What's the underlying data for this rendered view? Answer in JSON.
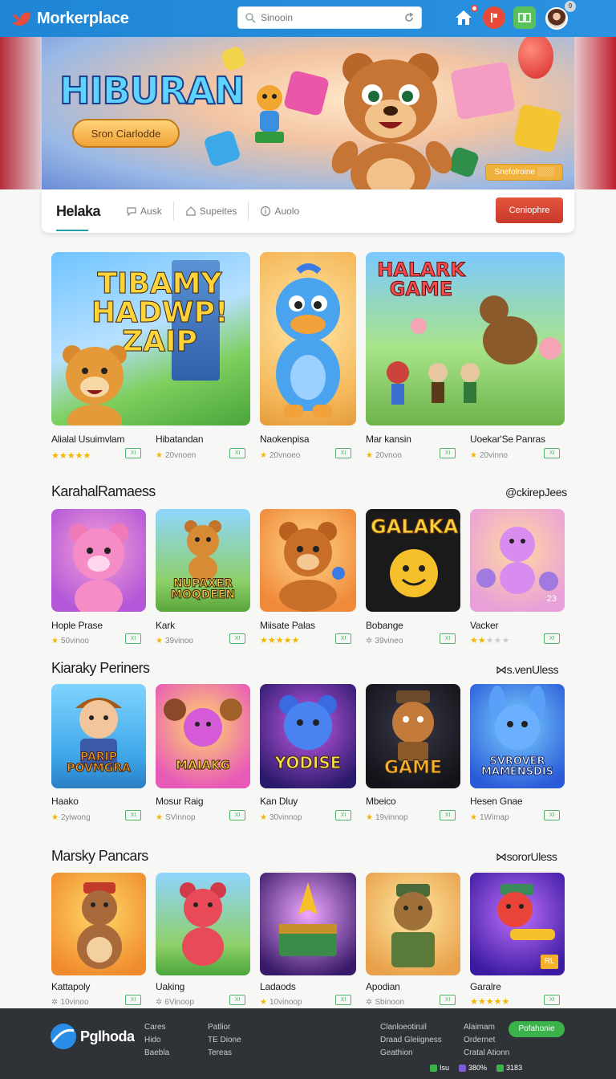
{
  "header": {
    "brand": "Morkerplace",
    "search_placeholder": "Sinooin",
    "avatar_count": "9"
  },
  "hero": {
    "title": "HIBURAN",
    "button_label": "Sron Ciarlodde",
    "chip_label": "Snefolroine ░░░"
  },
  "tabs": {
    "active": "Helaka",
    "items": [
      {
        "label": "Ausk",
        "icon": "chat-icon"
      },
      {
        "label": "Supeites",
        "icon": "house-icon"
      },
      {
        "label": "Auolo",
        "icon": "info-icon"
      }
    ],
    "cta_label": "Ceniophre"
  },
  "featured": [
    {
      "name": "Alialal Usuimvlam",
      "meta": "",
      "rating": 5,
      "tile_text": "TIBAMY HADWP! ZAIP"
    },
    {
      "name": "Hibatandan",
      "meta": "20vnoen",
      "rating": 1,
      "tile_text": ""
    },
    {
      "name": "Naokenpisa",
      "meta": "20vnoeo",
      "rating": 1,
      "tile_text": ""
    },
    {
      "name": "Mar kansin",
      "meta": "20vnoo",
      "rating": 1,
      "tile_text": "HALARK GAME"
    },
    {
      "name": "Uoekar'Se Panras",
      "meta": "20vinno",
      "rating": 1,
      "tile_text": ""
    }
  ],
  "sections": [
    {
      "title": "KarahalRamaess",
      "link": "@ckirepJees",
      "items": [
        {
          "name": "Hople Prase",
          "meta": "50vinoo",
          "rating": 1,
          "stars": 0,
          "tile_text": ""
        },
        {
          "name": "Kark",
          "meta": "39vinoo",
          "rating": 1,
          "stars": 0,
          "tile_text": "NUPAXER MOQDEEN"
        },
        {
          "name": "Miisate Palas",
          "meta": "",
          "rating": 0,
          "stars": 5,
          "tile_text": ""
        },
        {
          "name": "Bobange",
          "meta": "39vineo",
          "rating": 0,
          "stars": 0,
          "tile_text": "GALAKAI"
        },
        {
          "name": "Vacker",
          "meta": "",
          "rating": 0,
          "stars": 2,
          "tile_text": "23"
        }
      ]
    },
    {
      "title": "Kiaraky Periners",
      "link": "⋈s.venUless",
      "items": [
        {
          "name": "Haako",
          "meta": "2yiwong",
          "rating": 1,
          "stars": 0,
          "tile_text": "PARIP POVMGRA"
        },
        {
          "name": "Mosur Raig",
          "meta": "SVinnop",
          "rating": 1,
          "stars": 0,
          "tile_text": "MAIAKG"
        },
        {
          "name": "Kan Dluy",
          "meta": "30vinnop",
          "rating": 1,
          "stars": 0,
          "tile_text": "YODISE"
        },
        {
          "name": "Mbeico",
          "meta": "19vinnop",
          "rating": 1,
          "stars": 0,
          "tile_text": "GAME"
        },
        {
          "name": "Hesen Gnae",
          "meta": "1Wimap",
          "rating": 1,
          "stars": 0,
          "tile_text": "SVROVER MAMENSDIS"
        }
      ]
    },
    {
      "title": "Marsky Pancars",
      "link": "⋈sororUless",
      "items": [
        {
          "name": "Kattapoly",
          "meta": "10vinoo",
          "rating": 0,
          "stars": 0,
          "tile_text": ""
        },
        {
          "name": "Uaking",
          "meta": "6Vinoop",
          "rating": 0,
          "stars": 0,
          "tile_text": ""
        },
        {
          "name": "Ladaods",
          "meta": "10vinoop",
          "rating": 1,
          "stars": 0,
          "tile_text": ""
        },
        {
          "name": "Apodian",
          "meta": "Sbinoon",
          "rating": 0,
          "stars": 0,
          "tile_text": ""
        },
        {
          "name": "Garalre",
          "meta": "",
          "rating": 0,
          "stars": 5,
          "tile_text": "RL"
        }
      ]
    }
  ],
  "tag_label": "XI",
  "footer": {
    "brand": "Pglhoda",
    "col1": [
      "Cares",
      "Hido",
      "Baebla"
    ],
    "col2": [
      "Patlior",
      "TE Dione",
      "Tereas"
    ],
    "col3": [
      "Clanloeotiruil",
      "Draad Gleiigness",
      "Geathion"
    ],
    "col4": [
      "Alaimam",
      "Ordernet",
      "Cratal Ationn"
    ],
    "button_label": "Pofahonie",
    "stats": [
      {
        "label": "Isu",
        "color": "#3cb24a"
      },
      {
        "label": "380%",
        "color": "#7e5ad6"
      },
      {
        "label": "3183",
        "color": "#3cb24a"
      }
    ]
  },
  "colors": {
    "topbar": "#1f86d6",
    "accent_green": "#3cb24a",
    "accent_red": "#d9453a",
    "star": "#f2b600"
  }
}
